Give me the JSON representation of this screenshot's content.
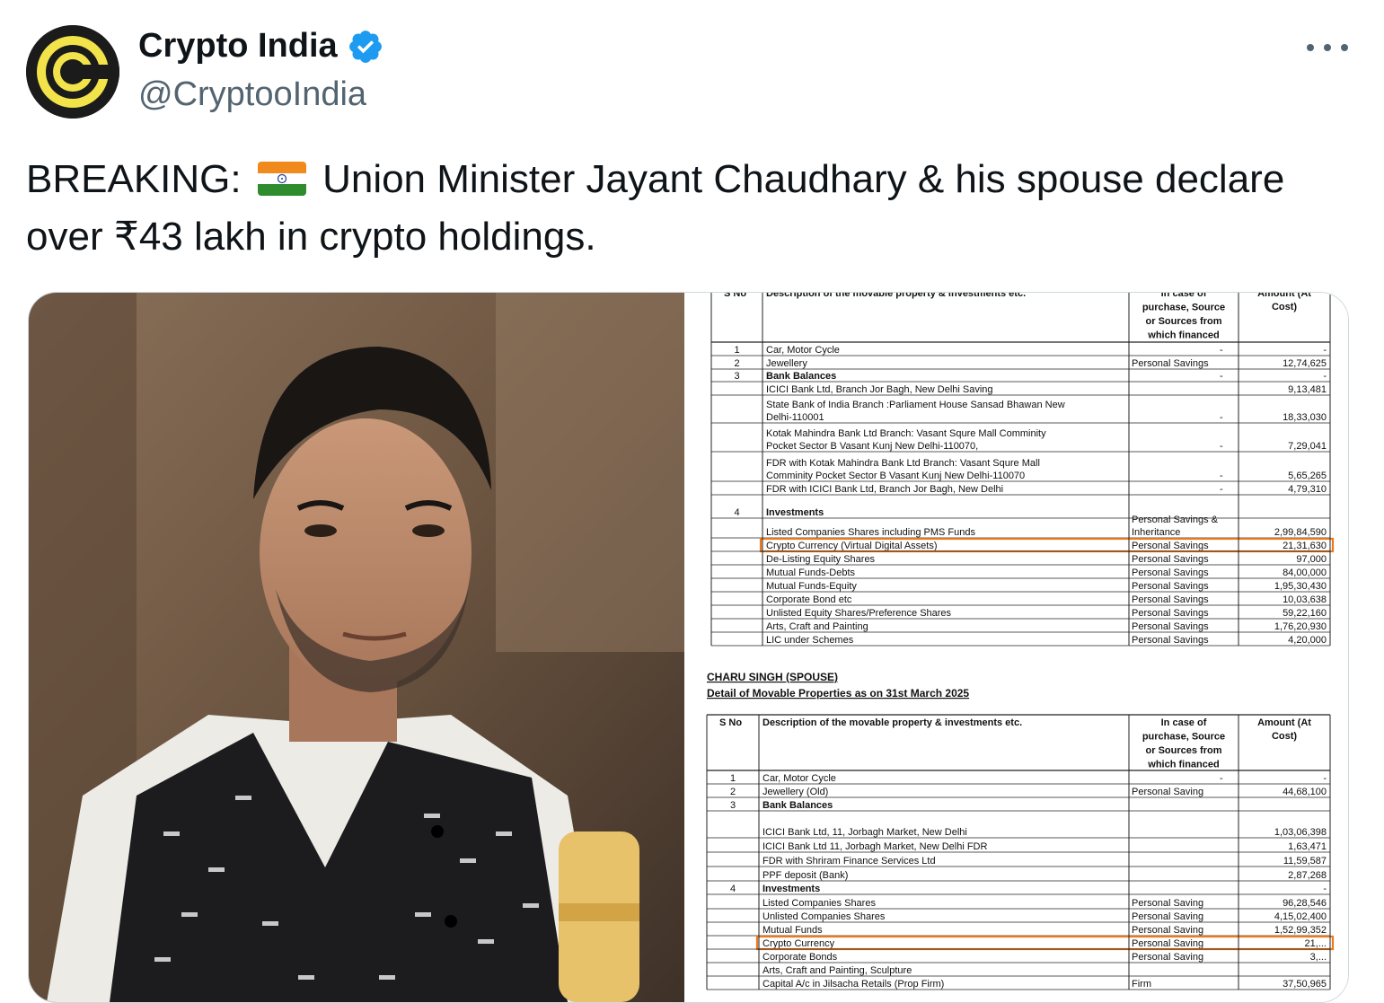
{
  "author": {
    "display_name": "Crypto India",
    "handle": "@CryptooIndia",
    "verified": true
  },
  "tweet": {
    "text_before_flag": "BREAKING: ",
    "text_after_flag": " Union Minister Jayant Chaudhary & his spouse declare over ₹43 lakh in crypto holdings."
  },
  "colors": {
    "accent": "#1d9bf0",
    "highlight": "#e8791e",
    "handle": "#536471"
  },
  "icons": {
    "verified": "verified-badge-icon",
    "more": "more-options-icon",
    "flag": "india-flag-emoji"
  },
  "doc": {
    "table1": {
      "headers": [
        "S No",
        "Description of the movable property & investments etc.",
        "In case of purchase, Source or Sources from which financed",
        "Amount (At Cost)"
      ],
      "rows": [
        {
          "sno": "1",
          "desc": "Car, Motor Cycle",
          "src": "-",
          "amt": "-"
        },
        {
          "sno": "2",
          "desc": "Jewellery",
          "src": "Personal Savings",
          "amt": "12,74,625"
        },
        {
          "sno": "3",
          "desc": "Bank Balances",
          "src": "-",
          "amt": "-"
        },
        {
          "sno": "",
          "desc": "ICICI Bank Ltd, Branch Jor Bagh, New Delhi Saving",
          "src": "",
          "amt": "9,13,481"
        },
        {
          "sno": "",
          "desc": "State Bank of India Branch :Parliament House Sansad Bhawan New Delhi-110001",
          "src": "-",
          "amt": "18,33,030"
        },
        {
          "sno": "",
          "desc": "Kotak Mahindra Bank Ltd Branch: Vasant Squre Mall Comminity Pocket Sector B Vasant Kunj New Delhi-110070,",
          "src": "-",
          "amt": "7,29,041"
        },
        {
          "sno": "",
          "desc": "FDR with Kotak Mahindra Bank Ltd Branch: Vasant Squre Mall Comminity Pocket Sector B Vasant Kunj New Delhi-110070",
          "src": "-",
          "amt": "5,65,265"
        },
        {
          "sno": "",
          "desc": "FDR with ICICI Bank Ltd, Branch Jor Bagh, New Delhi",
          "src": "-",
          "amt": "4,79,310"
        },
        {
          "sno": "4",
          "desc": "Investments",
          "src": "",
          "amt": ""
        },
        {
          "sno": "",
          "desc": "Listed Companies Shares including PMS Funds",
          "src": "Personal Savings & Inheritance",
          "amt": "2,99,84,590"
        },
        {
          "sno": "",
          "desc": "Crypto Currency (Virtual Digital Assets)",
          "src": "Personal Savings",
          "amt": "21,31,630"
        },
        {
          "sno": "",
          "desc": "De-Listing Equity Shares",
          "src": "Personal Savings",
          "amt": "97,000"
        },
        {
          "sno": "",
          "desc": "Mutual Funds-Debts",
          "src": "Personal Savings",
          "amt": "84,00,000"
        },
        {
          "sno": "",
          "desc": "Mutual Funds-Equity",
          "src": "Personal Savings",
          "amt": "1,95,30,430"
        },
        {
          "sno": "",
          "desc": "Corporate Bond etc",
          "src": "Personal Savings",
          "amt": "10,03,638"
        },
        {
          "sno": "",
          "desc": "Unlisted Equity Shares/Preference Shares",
          "src": "Personal Savings",
          "amt": "59,22,160"
        },
        {
          "sno": "",
          "desc": "Arts, Craft and Painting",
          "src": "Personal Savings",
          "amt": "1,76,20,930"
        },
        {
          "sno": "",
          "desc": "LIC under Schemes",
          "src": "Personal Savings",
          "amt": "4,20,000"
        }
      ]
    },
    "spouse_title": "CHARU SINGH (SPOUSE)",
    "spouse_subtitle": "Detail of Movable Properties as on 31st March 2025",
    "table2": {
      "headers": [
        "S No",
        "Description of the movable property & investments etc.",
        "In case of purchase, Source or Sources from which financed",
        "Amount (At Cost)"
      ],
      "rows": [
        {
          "sno": "1",
          "desc": "Car, Motor Cycle",
          "src": "-",
          "amt": "-"
        },
        {
          "sno": "2",
          "desc": "Jewellery (Old)",
          "src": "Personal Saving",
          "amt": "44,68,100"
        },
        {
          "sno": "3",
          "desc": "Bank Balances",
          "src": "",
          "amt": ""
        },
        {
          "sno": "",
          "desc": "ICICI Bank Ltd, 11, Jorbagh Market, New Delhi",
          "src": "",
          "amt": "1,03,06,398"
        },
        {
          "sno": "",
          "desc": "ICICI Bank Ltd 11, Jorbagh Market, New Delhi FDR",
          "src": "",
          "amt": "1,63,471"
        },
        {
          "sno": "",
          "desc": "FDR with Shriram Finance Services Ltd",
          "src": "",
          "amt": "11,59,587"
        },
        {
          "sno": "",
          "desc": "PPF deposit (Bank)",
          "src": "",
          "amt": "2,87,268"
        },
        {
          "sno": "4",
          "desc": "Investments",
          "src": "",
          "amt": "-"
        },
        {
          "sno": "",
          "desc": "Listed Companies Shares",
          "src": "Personal Saving",
          "amt": "96,28,546"
        },
        {
          "sno": "",
          "desc": "Unlisted Companies Shares",
          "src": "Personal Saving",
          "amt": "4,15,02,400"
        },
        {
          "sno": "",
          "desc": "Mutual Funds",
          "src": "Personal Saving",
          "amt": "1,52,99,352"
        },
        {
          "sno": "",
          "desc": "Crypto Currency",
          "src": "Personal Saving",
          "amt": "21,..."
        },
        {
          "sno": "",
          "desc": "Corporate Bonds",
          "src": "Personal Saving",
          "amt": "3,..."
        },
        {
          "sno": "",
          "desc": "Arts, Craft and Painting, Sculpture",
          "src": "",
          "amt": ""
        },
        {
          "sno": "",
          "desc": "Capital A/c in Jilsacha Retails (Prop Firm)",
          "src": "Firm",
          "amt": "37,50,965"
        }
      ]
    }
  }
}
